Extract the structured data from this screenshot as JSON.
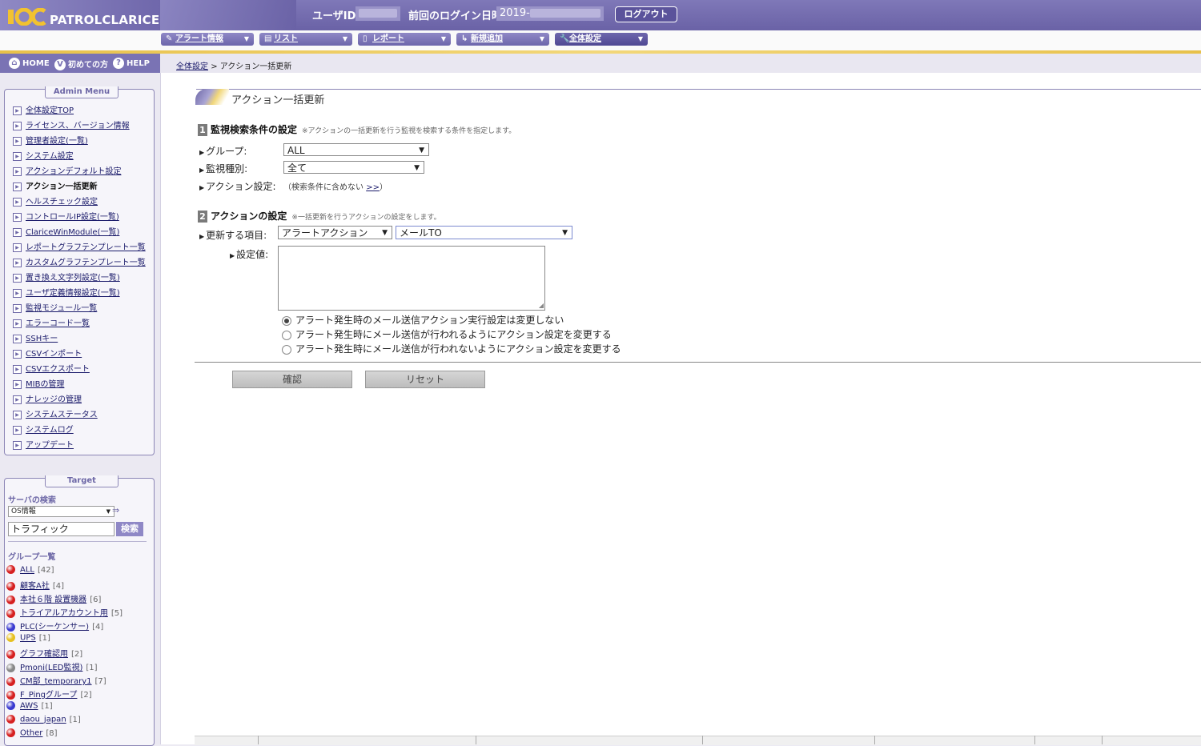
{
  "header": {
    "logo_text": "PATROLCLARICE",
    "userid_label": "ユーザID",
    "last_login_label": "前回のログイン日時",
    "last_login_value": "2019-",
    "logout_label": "ログアウト"
  },
  "menus": [
    {
      "label": "アラート情報",
      "icon": "✎"
    },
    {
      "label": "リスト",
      "icon": "▤"
    },
    {
      "label": "レポート",
      "icon": "▯"
    },
    {
      "label": "新規追加",
      "icon": "↳"
    },
    {
      "label": "全体設定",
      "icon": "🔧"
    }
  ],
  "nav": {
    "home": "HOME",
    "first": "初めての方",
    "help": "HELP"
  },
  "breadcrumb": {
    "parent": "全体設定",
    "sep": ">",
    "current": "アクション一括更新"
  },
  "admin_menu": {
    "title": "Admin Menu",
    "items": [
      "全体設定TOP",
      "ライセンス、バージョン情報",
      "管理者設定(一覧)",
      "システム設定",
      "アクションデフォルト設定",
      "アクション一括更新",
      "ヘルスチェック設定",
      "コントロールIP設定(一覧)",
      "ClariceWinModule(一覧)",
      "レポートグラフテンプレート一覧",
      "カスタムグラフテンプレート一覧",
      "置き換え文字列設定(一覧)",
      "ユーザ定義情報設定(一覧)",
      "監視モジュール一覧",
      "エラーコード一覧",
      "SSHキー",
      "CSVインポート",
      "CSVエクスポート",
      "MIBの管理",
      "ナレッジの管理",
      "システムステータス",
      "システムログ",
      "アップデート"
    ]
  },
  "target": {
    "title": "Target",
    "search_label": "サーバの検索",
    "search_type": "OS情報",
    "search_value": "トラフィック",
    "search_button": "検索",
    "group_label": "グループ一覧",
    "groups": [
      {
        "name": "ALL",
        "count": "[42]",
        "color": "#d62020"
      },
      {
        "name": "顧客A社",
        "count": "[4]",
        "color": "#d62020"
      },
      {
        "name": "本社６階 設置機器",
        "count": "[6]",
        "color": "#d62020"
      },
      {
        "name": "トライアルアカウント用",
        "count": "[5]",
        "color": "#d62020"
      },
      {
        "name": "PLC(シーケンサー)",
        "count": "[4]",
        "color": "#3a3ad0"
      },
      {
        "name": "UPS",
        "count": "[1]",
        "color": "#e6c020"
      },
      {
        "name": "グラフ確認用",
        "count": "[2]",
        "color": "#d62020"
      },
      {
        "name": "Pmoni(LED監視)",
        "count": "[1]",
        "color": "#888888"
      },
      {
        "name": "CM部_temporary1",
        "count": "[7]",
        "color": "#d62020"
      },
      {
        "name": "F_Pingグループ",
        "count": "[2]",
        "color": "#d62020"
      },
      {
        "name": "AWS",
        "count": "[1]",
        "color": "#3a3ad0"
      },
      {
        "name": "daou_japan",
        "count": "[1]",
        "color": "#d62020"
      },
      {
        "name": "Other",
        "count": "[8]",
        "color": "#d62020"
      }
    ]
  },
  "main": {
    "section_title": "アクション一括更新",
    "step1": {
      "num": "1",
      "title": "監視検索条件の設定",
      "note": "※アクションの一括更新を行う監視を検索する条件を指定します。",
      "group_label": "グループ:",
      "group_value": "ALL",
      "type_label": "監視種別:",
      "type_value": "全て",
      "action_label": "アクション設定:",
      "action_hint_open": "（検索条件に含めない",
      "action_hint_link": ">>",
      "action_hint_close": "）"
    },
    "step2": {
      "num": "2",
      "title": "アクションの設定",
      "note": "※一括更新を行うアクションの設定をします。",
      "item_label": "更新する項目:",
      "item_value1": "アラートアクション",
      "item_value2": "メールTO",
      "value_label": "設定値:",
      "radios": [
        "アラート発生時のメール送信アクション実行設定は変更しない",
        "アラート発生時にメール送信が行われるようにアクション設定を変更する",
        "アラート発生時にメール送信が行われないようにアクション設定を変更する"
      ],
      "radio_selected": 0
    },
    "confirm_label": "確認",
    "reset_label": "リセット"
  }
}
